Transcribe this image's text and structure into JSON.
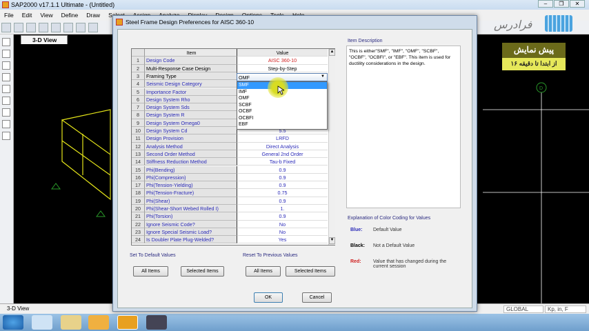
{
  "app": {
    "title": "SAP2000 v17.1.1 Ultimate  - (Untitled)",
    "menu": [
      "File",
      "Edit",
      "View",
      "Define",
      "Draw",
      "Select",
      "Assign",
      "Analyze",
      "Display",
      "Design",
      "Options",
      "Tools",
      "Help"
    ],
    "view_tab": "3-D View",
    "status_left": "3-D View",
    "coord_system": "GLOBAL",
    "units": "Kp, in, F"
  },
  "watermark": {
    "logo": "فرادرس",
    "promo_title": "پیش نمایش",
    "promo_sub": "از ابتدا تا دقیقه ۱۶"
  },
  "dialog": {
    "title": "Steel Frame Design Preferences for AISC 360-10",
    "columns": [
      "Item",
      "Value"
    ],
    "rows": [
      {
        "n": "1",
        "item": "Design Code",
        "value": "AISC 360-10",
        "color": "red"
      },
      {
        "n": "2",
        "item": "Multi-Response Case Design",
        "value": "Step-by-Step",
        "color": "black"
      },
      {
        "n": "3",
        "item": "Framing Type",
        "value": "OMF",
        "color": "black"
      },
      {
        "n": "4",
        "item": "Seismic Design Category",
        "value": "",
        "color": "blue"
      },
      {
        "n": "5",
        "item": "Importance Factor",
        "value": "",
        "color": "blue"
      },
      {
        "n": "6",
        "item": "Design System Rho",
        "value": "",
        "color": "blue"
      },
      {
        "n": "7",
        "item": "Design System Sds",
        "value": "",
        "color": "blue"
      },
      {
        "n": "8",
        "item": "Design System R",
        "value": "",
        "color": "blue"
      },
      {
        "n": "9",
        "item": "Design System Omega0",
        "value": "",
        "color": "blue"
      },
      {
        "n": "10",
        "item": "Design System Cd",
        "value": "5.5",
        "color": "blue"
      },
      {
        "n": "11",
        "item": "Design Provision",
        "value": "LRFD",
        "color": "blue"
      },
      {
        "n": "12",
        "item": "Analysis Method",
        "value": "Direct Analysis",
        "color": "blue"
      },
      {
        "n": "13",
        "item": "Second Order Method",
        "value": "General 2nd Order",
        "color": "blue"
      },
      {
        "n": "14",
        "item": "Stiffness Reduction Method",
        "value": "Tau-b Fixed",
        "color": "blue"
      },
      {
        "n": "15",
        "item": "Phi(Bending)",
        "value": "0.9",
        "color": "blue"
      },
      {
        "n": "16",
        "item": "Phi(Compression)",
        "value": "0.9",
        "color": "blue"
      },
      {
        "n": "17",
        "item": "Phi(Tension-Yielding)",
        "value": "0.9",
        "color": "blue"
      },
      {
        "n": "18",
        "item": "Phi(Tension-Fracture)",
        "value": "0.75",
        "color": "blue"
      },
      {
        "n": "19",
        "item": "Phi(Shear)",
        "value": "0.9",
        "color": "blue"
      },
      {
        "n": "20",
        "item": "Phi(Shear-Short Webed Rolled I)",
        "value": "1.",
        "color": "blue"
      },
      {
        "n": "21",
        "item": "Phi(Torsion)",
        "value": "0.9",
        "color": "blue"
      },
      {
        "n": "22",
        "item": "Ignore Seismic Code?",
        "value": "No",
        "color": "blue"
      },
      {
        "n": "23",
        "item": "Ignore Special Seismic Load?",
        "value": "No",
        "color": "blue"
      },
      {
        "n": "24",
        "item": "Is Doubler Plate Plug-Welded?",
        "value": "Yes",
        "color": "blue"
      }
    ],
    "dropdown": {
      "selected": "OMF",
      "highlighted": "SMF",
      "options": [
        "SMF",
        "IMF",
        "OMF",
        "SCBF",
        "OCBF",
        "OCBFI",
        "EBF"
      ]
    },
    "description_label": "Item Description",
    "description": "This is either\"SMF\", \"IMF\", \"OMF\", \"SCBF\", \"OCBF\", \"OCBFI\", or \"EBF\".  This item is used for ductility considerations in the design.",
    "color_coding": {
      "title": "Explanation of Color Coding for Values",
      "entries": [
        {
          "key": "Blue:",
          "text": "Default Value",
          "color": "#2a2ab8"
        },
        {
          "key": "Black:",
          "text": "Not a Default Value",
          "color": "#000000"
        },
        {
          "key": "Red:",
          "text": "Value that has changed during the current session",
          "color": "#d02020"
        }
      ]
    },
    "set_default": {
      "label": "Set To Default Values",
      "all": "All Items",
      "selected": "Selected Items"
    },
    "reset_previous": {
      "label": "Reset To Previous Values",
      "all": "All Items",
      "selected": "Selected Items"
    },
    "ok": "OK",
    "cancel": "Cancel"
  }
}
